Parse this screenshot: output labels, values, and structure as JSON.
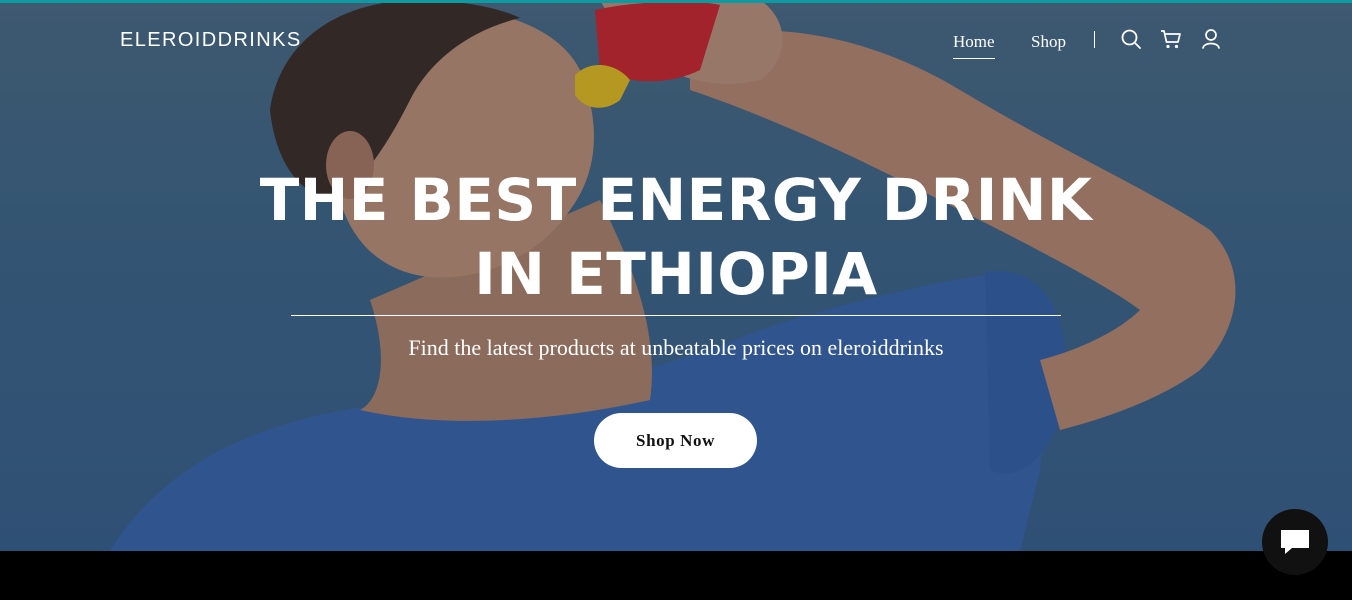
{
  "header": {
    "brand": "ELEROIDDRINKS",
    "nav": [
      {
        "label": "Home",
        "active": true
      },
      {
        "label": "Shop",
        "active": false
      }
    ],
    "icons": [
      "search-icon",
      "cart-icon",
      "user-icon"
    ]
  },
  "hero": {
    "title_line1": "THE BEST ENERGY DRINK",
    "title_line2": "IN ETHIOPIA",
    "subtitle": "Find the latest products at unbeatable prices on eleroiddrinks",
    "cta_label": "Shop Now",
    "background_image": "man-drinking-from-bottle"
  },
  "chat": {
    "icon": "chat-bubble-icon"
  },
  "colors": {
    "accent": "#0e9aa0",
    "sky": "#3f6a8d",
    "shirt": "#3b6bb3",
    "text": "#ffffff",
    "button_bg": "#ffffff",
    "chat_bg": "#111111"
  }
}
